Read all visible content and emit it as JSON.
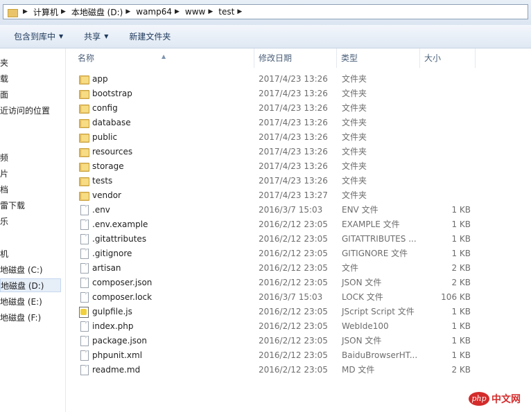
{
  "breadcrumb": [
    "计算机",
    "本地磁盘 (D:)",
    "wamp64",
    "www",
    "test"
  ],
  "toolbar": {
    "include_in_library": "包含到库中",
    "share": "共享",
    "new_folder": "新建文件夹"
  },
  "nav": [
    "夹",
    "载",
    "面",
    "近访问的位置",
    "频",
    "片",
    "档",
    "雷下载",
    "乐",
    "机",
    "地磁盘 (C:)",
    "地磁盘 (D:)",
    "地磁盘 (E:)",
    "地磁盘 (F:)"
  ],
  "nav_selected_index": 11,
  "columns": {
    "name": "名称",
    "date": "修改日期",
    "type": "类型",
    "size": "大小"
  },
  "files": [
    {
      "name": "app",
      "date": "2017/4/23 13:26",
      "type": "文件夹",
      "size": "",
      "icon": "folder-icon"
    },
    {
      "name": "bootstrap",
      "date": "2017/4/23 13:26",
      "type": "文件夹",
      "size": "",
      "icon": "folder-icon"
    },
    {
      "name": "config",
      "date": "2017/4/23 13:26",
      "type": "文件夹",
      "size": "",
      "icon": "folder-icon"
    },
    {
      "name": "database",
      "date": "2017/4/23 13:26",
      "type": "文件夹",
      "size": "",
      "icon": "folder-icon"
    },
    {
      "name": "public",
      "date": "2017/4/23 13:26",
      "type": "文件夹",
      "size": "",
      "icon": "folder-icon"
    },
    {
      "name": "resources",
      "date": "2017/4/23 13:26",
      "type": "文件夹",
      "size": "",
      "icon": "folder-icon"
    },
    {
      "name": "storage",
      "date": "2017/4/23 13:26",
      "type": "文件夹",
      "size": "",
      "icon": "folder-icon"
    },
    {
      "name": "tests",
      "date": "2017/4/23 13:26",
      "type": "文件夹",
      "size": "",
      "icon": "folder-icon"
    },
    {
      "name": "vendor",
      "date": "2017/4/23 13:27",
      "type": "文件夹",
      "size": "",
      "icon": "folder-icon"
    },
    {
      "name": ".env",
      "date": "2016/3/7 15:03",
      "type": "ENV 文件",
      "size": "1 KB",
      "icon": "file-icon"
    },
    {
      "name": ".env.example",
      "date": "2016/2/12 23:05",
      "type": "EXAMPLE 文件",
      "size": "1 KB",
      "icon": "file-icon"
    },
    {
      "name": ".gitattributes",
      "date": "2016/2/12 23:05",
      "type": "GITATTRIBUTES ...",
      "size": "1 KB",
      "icon": "file-icon"
    },
    {
      "name": ".gitignore",
      "date": "2016/2/12 23:05",
      "type": "GITIGNORE 文件",
      "size": "1 KB",
      "icon": "file-icon"
    },
    {
      "name": "artisan",
      "date": "2016/2/12 23:05",
      "type": "文件",
      "size": "2 KB",
      "icon": "file-icon"
    },
    {
      "name": "composer.json",
      "date": "2016/2/12 23:05",
      "type": "JSON 文件",
      "size": "2 KB",
      "icon": "file-icon"
    },
    {
      "name": "composer.lock",
      "date": "2016/3/7 15:03",
      "type": "LOCK 文件",
      "size": "106 KB",
      "icon": "file-icon"
    },
    {
      "name": "gulpfile.js",
      "date": "2016/2/12 23:05",
      "type": "JScript Script 文件",
      "size": "1 KB",
      "icon": "script-icon"
    },
    {
      "name": "index.php",
      "date": "2016/2/12 23:05",
      "type": "WebIde100",
      "size": "1 KB",
      "icon": "file-icon"
    },
    {
      "name": "package.json",
      "date": "2016/2/12 23:05",
      "type": "JSON 文件",
      "size": "1 KB",
      "icon": "file-icon"
    },
    {
      "name": "phpunit.xml",
      "date": "2016/2/12 23:05",
      "type": "BaiduBrowserHT...",
      "size": "1 KB",
      "icon": "file-icon"
    },
    {
      "name": "readme.md",
      "date": "2016/2/12 23:05",
      "type": "MD 文件",
      "size": "2 KB",
      "icon": "file-icon"
    }
  ],
  "watermark": {
    "logo": "php",
    "text": "中文网"
  }
}
